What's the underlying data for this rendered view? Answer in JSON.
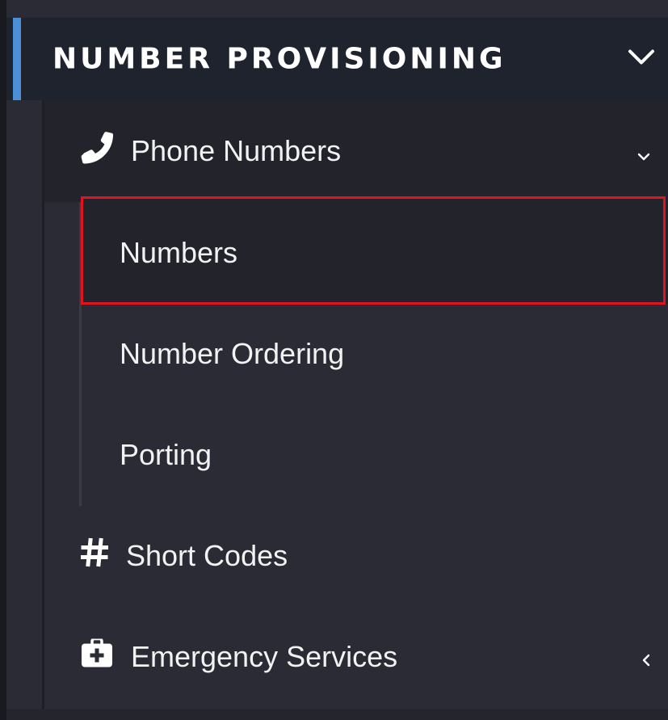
{
  "sidebar": {
    "section": {
      "title": "NUMBER PROVISIONING",
      "expanded": true
    },
    "phone_numbers": {
      "label": "Phone Numbers",
      "icon": "phone-icon",
      "children": [
        {
          "label": "Numbers",
          "selected": true
        },
        {
          "label": "Number Ordering",
          "selected": false
        },
        {
          "label": "Porting",
          "selected": false
        }
      ]
    },
    "short_codes": {
      "label": "Short Codes",
      "icon": "hash-icon"
    },
    "emergency_services": {
      "label": "Emergency Services",
      "icon": "medical-kit-icon"
    }
  },
  "colors": {
    "accent": "#4a8fd8",
    "selection_outline": "#e0141c",
    "panel_bg": "#2a2b34",
    "header_bg": "#1f232e"
  }
}
